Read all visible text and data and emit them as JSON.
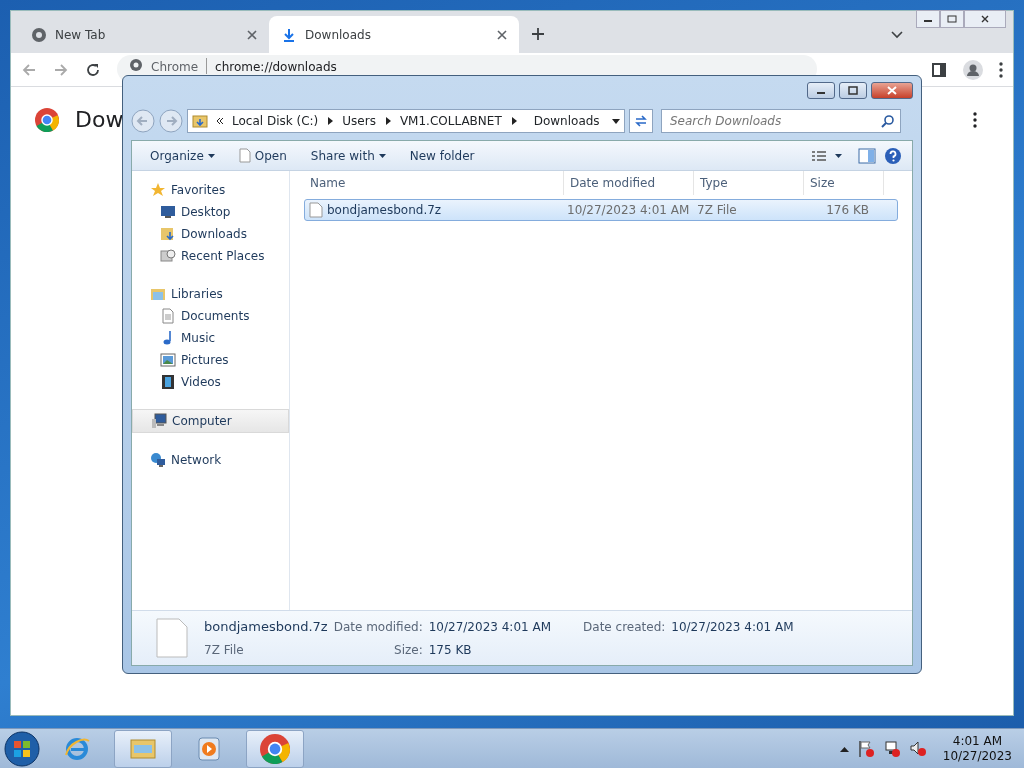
{
  "chrome": {
    "tabs": [
      {
        "label": "New Tab",
        "selected": false,
        "kind": "chrome"
      },
      {
        "label": "Downloads",
        "selected": true,
        "kind": "download"
      }
    ],
    "address": {
      "site": "Chrome",
      "url": "chrome://downloads"
    },
    "page": {
      "heading": "Dow"
    }
  },
  "explorer": {
    "breadcrumb": [
      "Local Disk (C:)",
      "Users",
      "VM1.COLLABNET",
      "Downloads"
    ],
    "search": {
      "placeholder": "Search Downloads"
    },
    "toolbar": [
      {
        "label": "Organize",
        "dropdown": true,
        "kind": "menu"
      },
      {
        "label": "Open",
        "dropdown": false,
        "kind": "open"
      },
      {
        "label": "Share with",
        "dropdown": true,
        "kind": "menu"
      },
      {
        "label": "New folder",
        "dropdown": false,
        "kind": "menu"
      }
    ],
    "nav": [
      {
        "label": "Favorites",
        "kind": "star",
        "selected": false,
        "children": [
          {
            "label": "Desktop",
            "kind": "desktop",
            "selected": false
          },
          {
            "label": "Downloads",
            "kind": "downloads",
            "selected": false
          },
          {
            "label": "Recent Places",
            "kind": "recent",
            "selected": false
          }
        ]
      },
      {
        "label": "Libraries",
        "kind": "libraries",
        "selected": false,
        "children": [
          {
            "label": "Documents",
            "kind": "documents",
            "selected": false
          },
          {
            "label": "Music",
            "kind": "music",
            "selected": false
          },
          {
            "label": "Pictures",
            "kind": "pictures",
            "selected": false
          },
          {
            "label": "Videos",
            "kind": "videos",
            "selected": false
          }
        ]
      },
      {
        "label": "Computer",
        "kind": "computer",
        "selected": true
      },
      {
        "label": "Network",
        "kind": "network",
        "selected": false
      }
    ],
    "columns": [
      "Name",
      "Date modified",
      "Type",
      "Size"
    ],
    "files": [
      {
        "name": "bondjamesbond.7z",
        "date": "10/27/2023 4:01 AM",
        "type": "7Z File",
        "size": "176 KB",
        "selected": true
      }
    ],
    "details": {
      "name": "bondjamesbond.7z",
      "type": "7Z File",
      "fields": [
        {
          "label": "Date modified:",
          "value": "10/27/2023 4:01 AM"
        },
        {
          "label": "Date created:",
          "value": "10/27/2023 4:01 AM"
        },
        {
          "label": "Size:",
          "value": "175 KB"
        }
      ]
    }
  },
  "taskbar": {
    "apps": [
      {
        "kind": "ie",
        "active": false
      },
      {
        "kind": "explorer",
        "active": true
      },
      {
        "kind": "media",
        "active": false
      },
      {
        "kind": "chrome",
        "active": true
      }
    ],
    "time": "4:01 AM",
    "date": "10/27/2023"
  }
}
